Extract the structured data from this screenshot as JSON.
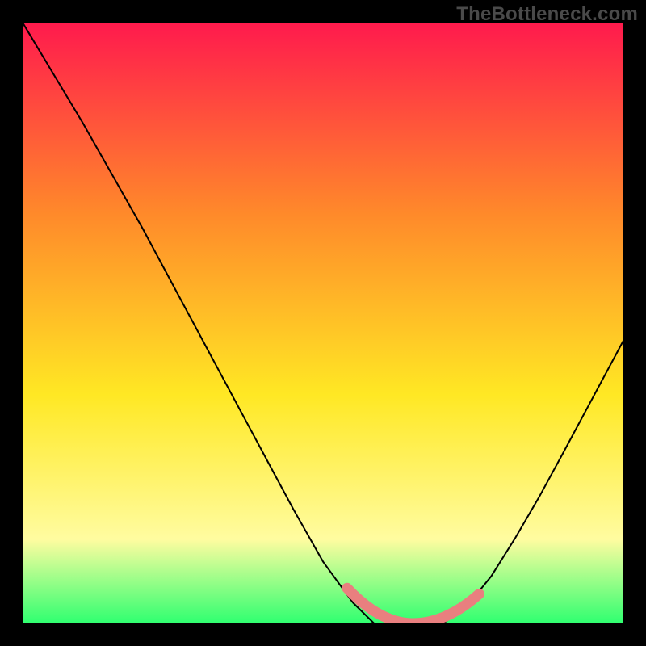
{
  "watermark": "TheBottleneck.com",
  "colors": {
    "bg": "#000000",
    "grad_top": "#ff1a4d",
    "grad_mid1": "#ff8a2a",
    "grad_mid2": "#ffe824",
    "grad_low": "#fffca0",
    "grad_bottom": "#2fff70",
    "curve": "#000000",
    "flat_segment": "#e97f7f",
    "watermark": "#4a4a4a"
  },
  "chart_data": {
    "type": "line",
    "title": "",
    "xlabel": "",
    "ylabel": "",
    "xlim": [
      0,
      1
    ],
    "ylim": [
      0,
      1.02
    ],
    "series": [
      {
        "name": "bottleneck-curve",
        "x": [
          0.0,
          0.05,
          0.1,
          0.15,
          0.2,
          0.25,
          0.3,
          0.35,
          0.4,
          0.45,
          0.5,
          0.55,
          0.585,
          0.62,
          0.66,
          0.7,
          0.74,
          0.78,
          0.82,
          0.86,
          0.9,
          0.95,
          1.0
        ],
        "y": [
          1.02,
          0.935,
          0.85,
          0.76,
          0.67,
          0.575,
          0.48,
          0.385,
          0.29,
          0.195,
          0.105,
          0.035,
          0.0,
          0.0,
          0.0,
          0.0,
          0.03,
          0.08,
          0.145,
          0.215,
          0.29,
          0.385,
          0.48
        ]
      }
    ],
    "flat_segment": {
      "name": "optimal-zone",
      "x_start": 0.54,
      "x_end": 0.76,
      "y_start": 0.06,
      "y_mid": 0.0,
      "y_end": 0.05,
      "stroke_width": 13
    },
    "gradient_stops": [
      {
        "offset": 0.0,
        "color": "#ff1a4d"
      },
      {
        "offset": 0.32,
        "color": "#ff8a2a"
      },
      {
        "offset": 0.62,
        "color": "#ffe824"
      },
      {
        "offset": 0.86,
        "color": "#fffca0"
      },
      {
        "offset": 1.0,
        "color": "#2fff70"
      }
    ]
  }
}
